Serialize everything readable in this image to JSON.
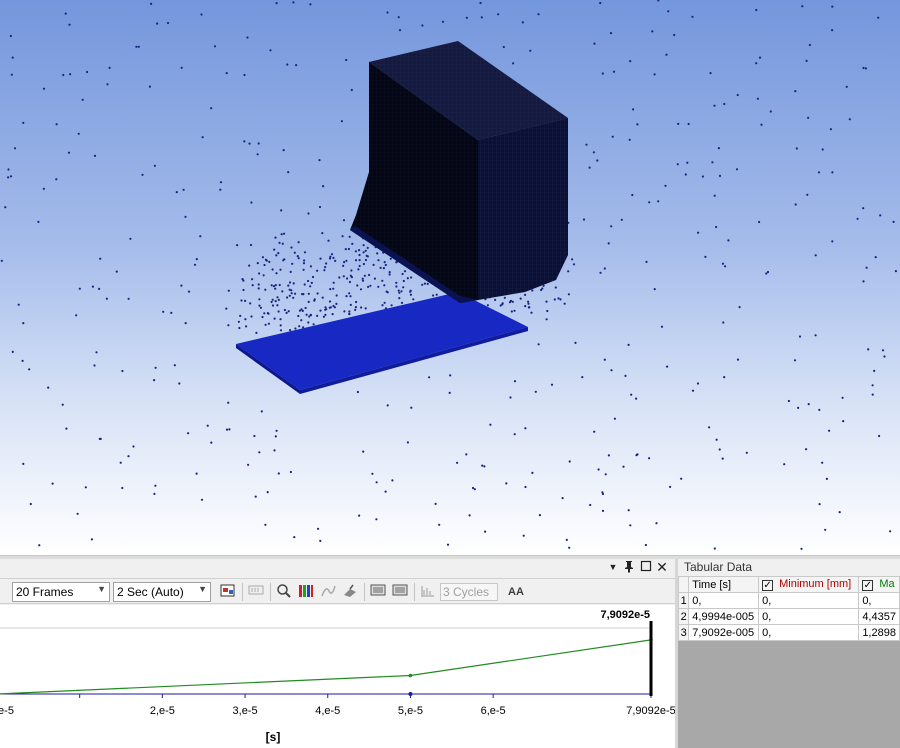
{
  "graph": {
    "frames_label": "20 Frames",
    "duration_label": "2 Sec (Auto)",
    "cycles_label": "3 Cycles",
    "aa_label": "AA",
    "current_time_label": "7,9092e-5",
    "x_unit_label": "[s]",
    "x_ticks": [
      "e-5",
      "2,e-5",
      "3,e-5",
      "4,e-5",
      "5,e-5",
      "6,e-5",
      "7,9092e-5"
    ]
  },
  "chart_data": {
    "type": "line",
    "x": [
      0,
      4.9994e-05,
      7.9092e-05
    ],
    "series": [
      {
        "values": [
          0,
          0.28,
          0.82
        ]
      }
    ],
    "xlabel": "[s]",
    "xlim": [
      0,
      7.9092e-05
    ],
    "ylim": [
      0,
      1
    ]
  },
  "tabular": {
    "title": "Tabular Data",
    "headers": {
      "time": "Time [s]",
      "minimum": "Minimum [mm]",
      "maximum": "Ma"
    },
    "rows": [
      {
        "n": "1",
        "time": "0,",
        "min": "0,",
        "max": "0,"
      },
      {
        "n": "2",
        "time": "4,9994e-005",
        "min": "0,",
        "max": "4,4357"
      },
      {
        "n": "3",
        "time": "7,9092e-005",
        "min": "0,",
        "max": "1,2898"
      }
    ],
    "colors": {
      "minimum": "#b00000",
      "maximum": "#008000"
    }
  },
  "colors": {
    "curve": "#228b22",
    "mesh_dark": "#0a0a2a",
    "plate": "#1c2bc8",
    "particle": "#1a237e"
  },
  "icons": {
    "dropdown": "dropdown-arrow-icon",
    "pin": "pin-icon",
    "maximize": "maximize-icon",
    "close": "close-icon"
  }
}
